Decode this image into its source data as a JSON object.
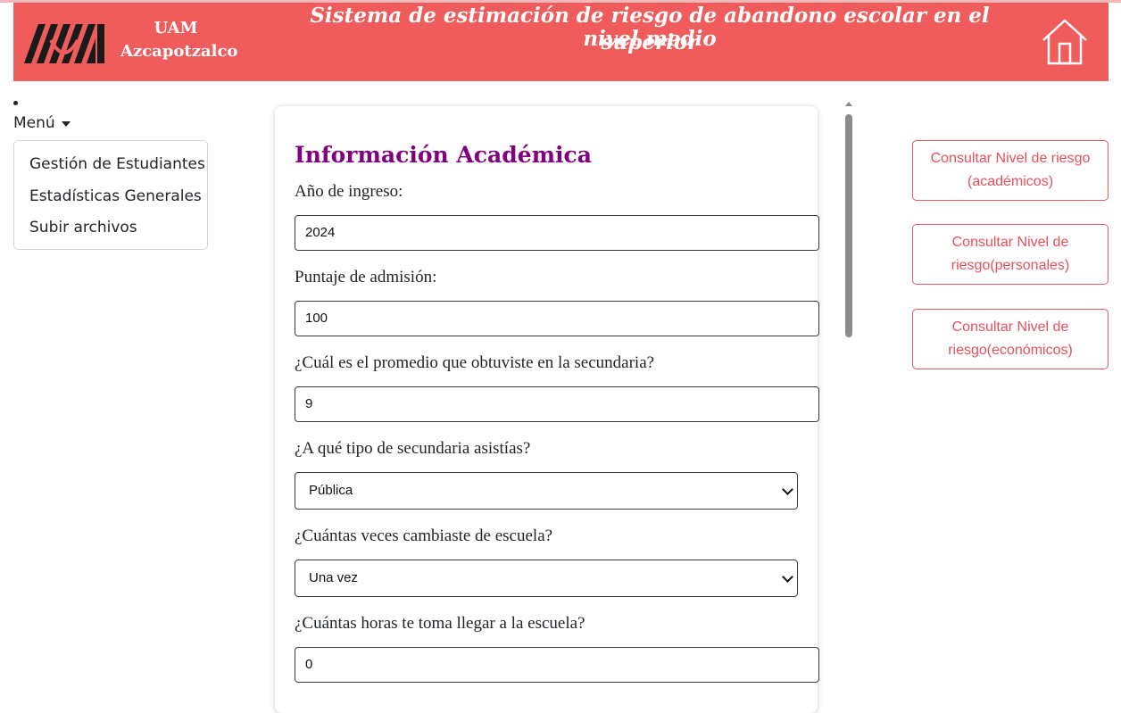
{
  "header": {
    "brand_line1": "UAM",
    "brand_line2": "Azcapotzalco",
    "title_line1": "Sistema de estimación de riesgo de abandono escolar en el nivel medio",
    "title_line2": "superior",
    "home_icon": "home-icon",
    "background_color": "#f05c5c"
  },
  "sidebar": {
    "menu_label": "Menú",
    "items": [
      {
        "label": "Gestión de Estudiantes"
      },
      {
        "label": "Estadísticas Generales"
      },
      {
        "label": "Subir archivos"
      }
    ]
  },
  "form": {
    "section_title": "Información Académica",
    "title_color": "#800080",
    "fields": [
      {
        "label": "Año de ingreso:",
        "value": "2024"
      },
      {
        "label": "Puntaje de admisión:",
        "value": "100"
      },
      {
        "label": "¿Cuál es el promedio que obtuviste en la secundaria?",
        "value": "9"
      },
      {
        "label": "¿A qué tipo de secundaria asistías?",
        "value": "Pública"
      },
      {
        "label": "¿Cuántas veces cambiaste de escuela?",
        "value": "Una vez"
      },
      {
        "label": "¿Cuántas horas te toma llegar a la escuela?",
        "value": "0"
      }
    ]
  },
  "right_buttons": [
    {
      "label": "Consultar Nivel de riesgo (académicos)"
    },
    {
      "label": "Consultar Nivel de riesgo(personales)"
    },
    {
      "label": "Consultar Nivel de riesgo(económicos)"
    }
  ],
  "accent_color": "#e8505a"
}
